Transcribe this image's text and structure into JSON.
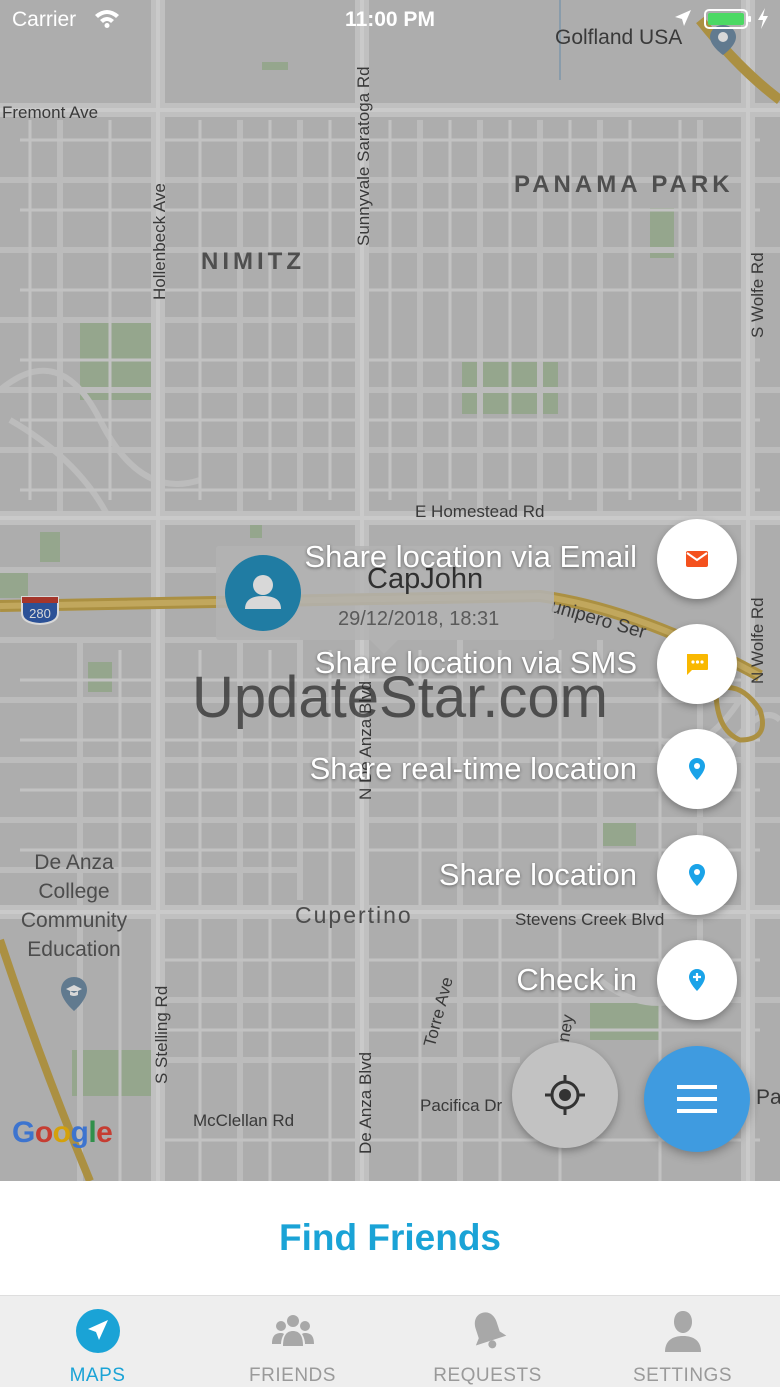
{
  "status_bar": {
    "carrier": "Carrier",
    "time": "11:00 PM"
  },
  "map": {
    "area_labels": [
      "PANAMA PARK",
      "NIMITZ"
    ],
    "city_label": "Cupertino",
    "road_labels": {
      "fremont": "Fremont Ave",
      "saratoga": "Sunnyvale Saratoga Rd",
      "hollenbeck": "Hollenbeck Ave",
      "wolfe_top": "S Wolfe Rd",
      "homestead": "E Homestead Rd",
      "junipero": "unipero Ser",
      "wolfe_bottom": "N Wolfe Rd",
      "n_de_anza": "N De Anza Blvd",
      "stevens_creek": "Stevens Creek Blvd",
      "torre": "Torre Ave",
      "stelling": "S Stelling Rd",
      "mcclellan": "McClellan Rd",
      "pacifica": "Pacifica Dr",
      "de_anza": "De Anza Blvd",
      "blaney": "ney"
    },
    "highway_shield": "280",
    "poi_golfland": "Golfland USA",
    "poi_college": [
      "De Anza",
      "College",
      "Community",
      "Education"
    ],
    "google_logo": "Google",
    "edge_label": "Pa"
  },
  "user_marker": {
    "name": "CapJohn",
    "timestamp": "29/12/2018, 18:31"
  },
  "watermark": "UpdateStar.com",
  "actions": [
    {
      "label": "Share location via Email",
      "icon": "email-icon",
      "color": "#f4511e"
    },
    {
      "label": "Share location via SMS",
      "icon": "sms-icon",
      "color": "#f9b800"
    },
    {
      "label": "Share real-time location",
      "icon": "location-pin-icon",
      "color": "#1aa3e8"
    },
    {
      "label": "Share location",
      "icon": "location-pin-icon",
      "color": "#1aa3e8"
    },
    {
      "label": "Check in",
      "icon": "check-in-pin-icon",
      "color": "#1aa3e8"
    }
  ],
  "find_friends": "Find Friends",
  "tabs": [
    {
      "label": "MAPS",
      "icon": "navigation-arrow-icon",
      "active": true
    },
    {
      "label": "FRIENDS",
      "icon": "group-icon",
      "active": false
    },
    {
      "label": "REQUESTS",
      "icon": "bell-icon",
      "active": false
    },
    {
      "label": "SETTINGS",
      "icon": "person-icon",
      "active": false
    }
  ],
  "colors": {
    "accent": "#1aa3d6",
    "fab": "#3f9be0",
    "avatar": "#1f8fbf"
  }
}
